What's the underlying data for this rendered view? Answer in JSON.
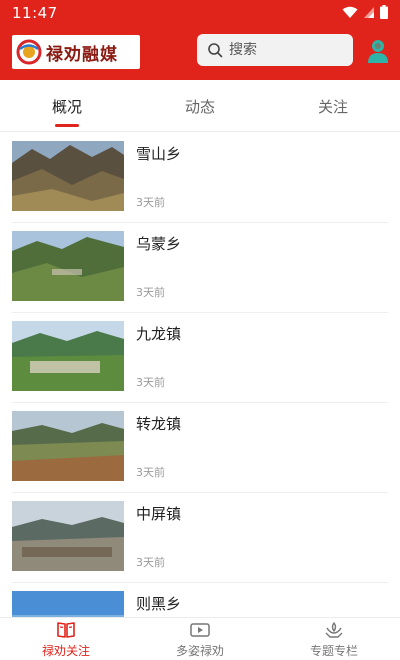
{
  "status_bar": {
    "time": "11:47",
    "icons": [
      "wifi-icon",
      "signal-icon",
      "battery-icon"
    ]
  },
  "header": {
    "logo_text": "禄劝融媒",
    "search": {
      "placeholder": "搜索",
      "icon": "search-icon"
    },
    "user_icon": "user-icon"
  },
  "colors": {
    "accent": "#e0241c",
    "brand_dark": "#8b1a12"
  },
  "tabs": [
    {
      "label": "概况",
      "active": true
    },
    {
      "label": "动态",
      "active": false
    },
    {
      "label": "关注",
      "active": false
    }
  ],
  "list": {
    "items": [
      {
        "title": "雪山乡",
        "time": "3天前"
      },
      {
        "title": "乌蒙乡",
        "time": "3天前"
      },
      {
        "title": "九龙镇",
        "time": "3天前"
      },
      {
        "title": "转龙镇",
        "time": "3天前"
      },
      {
        "title": "中屏镇",
        "time": "3天前"
      },
      {
        "title": "则黑乡",
        "time": ""
      }
    ]
  },
  "bottom_nav": [
    {
      "label": "禄劝关注",
      "icon": "book-icon",
      "active": true
    },
    {
      "label": "多姿禄劝",
      "icon": "video-icon",
      "active": false
    },
    {
      "label": "专题专栏",
      "icon": "lotus-hands-icon",
      "active": false
    }
  ]
}
